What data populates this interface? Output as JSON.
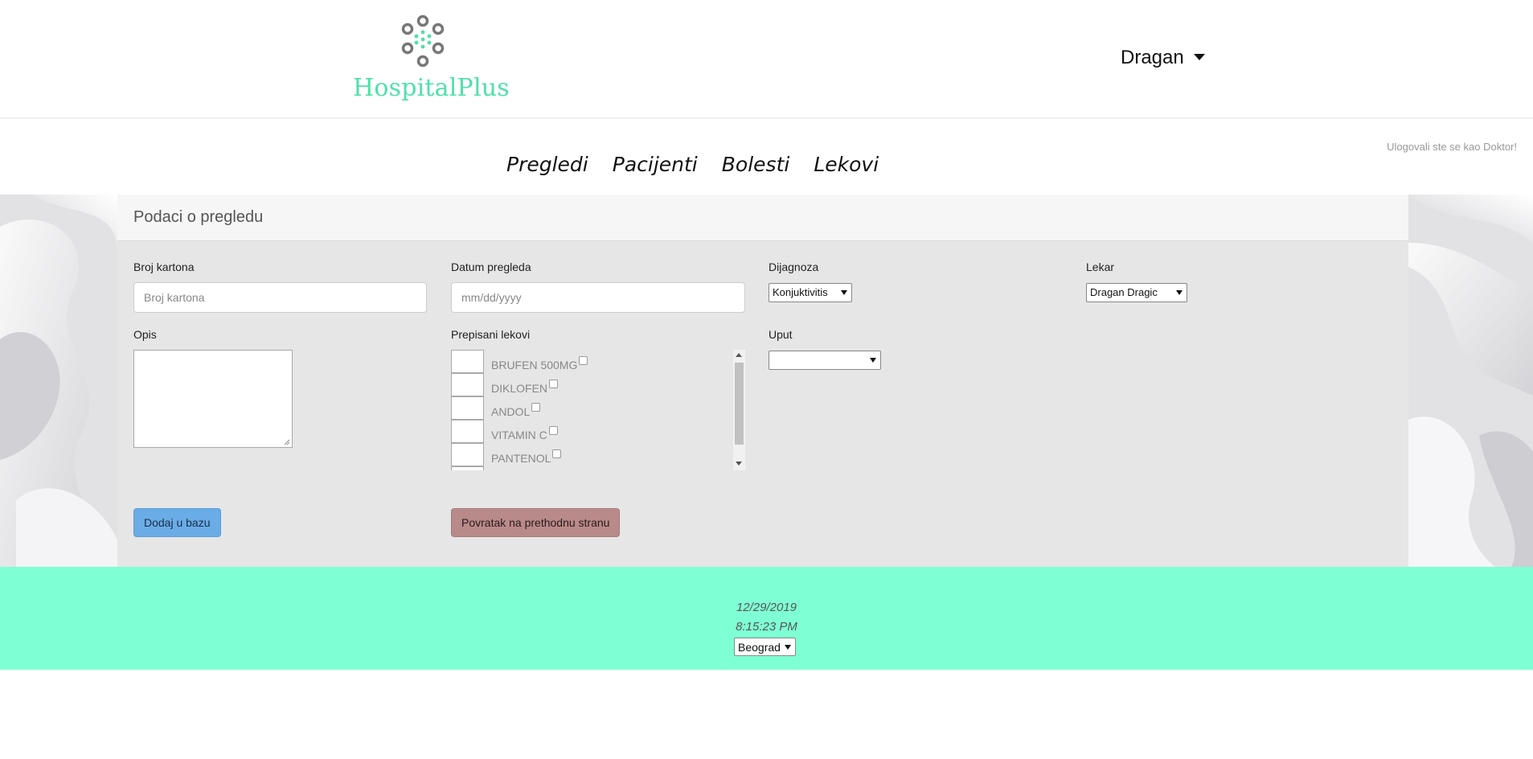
{
  "header": {
    "brand": "HospitalPlus",
    "user_name": "Dragan"
  },
  "nav": {
    "items": [
      "Pregledi",
      "Pacijenti",
      "Bolesti",
      "Lekovi"
    ],
    "login_note": "Ulogovali ste se kao Doktor!"
  },
  "form": {
    "title": "Podaci o pregledu",
    "broj_kartona": {
      "label": "Broj kartona",
      "placeholder": "Broj kartona",
      "value": ""
    },
    "datum_pregleda": {
      "label": "Datum pregleda",
      "placeholder": "mm/dd/yyyy",
      "value": ""
    },
    "dijagnoza": {
      "label": "Dijagnoza",
      "selected": "Konjuktivitis"
    },
    "lekar": {
      "label": "Lekar",
      "selected": "Dragan Dragic"
    },
    "opis": {
      "label": "Opis",
      "value": ""
    },
    "prepisani_lekovi": {
      "label": "Prepisani lekovi",
      "items": [
        {
          "name": "BRUFEN 500MG",
          "checked": false
        },
        {
          "name": "DIKLOFEN",
          "checked": false
        },
        {
          "name": "ANDOL",
          "checked": false
        },
        {
          "name": "VITAMIN C",
          "checked": false
        },
        {
          "name": "PANTENOL",
          "checked": false
        }
      ]
    },
    "uput": {
      "label": "Uput",
      "selected": ""
    },
    "submit_label": "Dodaj u bazu",
    "back_label": "Povratak na prethodnu stranu"
  },
  "footer": {
    "date": "12/29/2019",
    "time": "8:15:23 PM",
    "city": "Beograd"
  },
  "colors": {
    "brand": "#4fe0a8",
    "footer_bg": "#7fffd4",
    "primary_button": "#6aace6",
    "back_button": "#b98a8a"
  }
}
